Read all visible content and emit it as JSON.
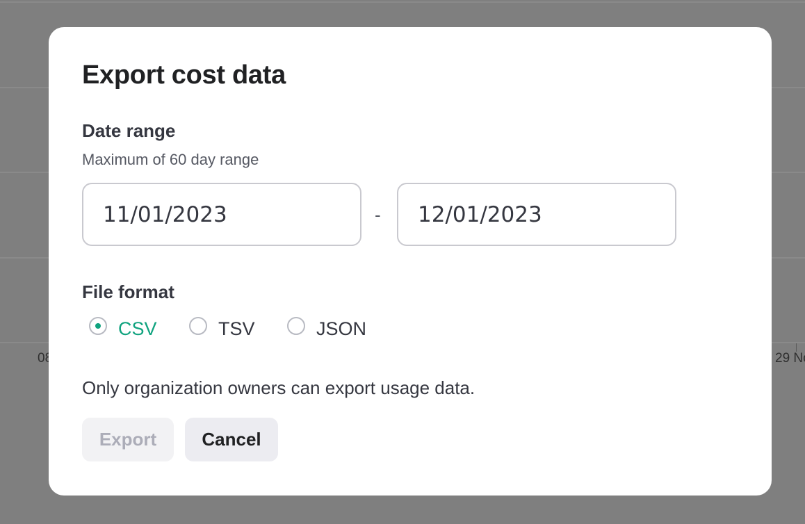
{
  "background_chart": {
    "x_ticks": [
      "08",
      "29 No"
    ]
  },
  "dialog": {
    "title": "Export cost data",
    "date_range": {
      "label": "Date range",
      "hint": "Maximum of 60 day range",
      "start_value": "11/01/2023",
      "separator": "-",
      "end_value": "12/01/2023"
    },
    "file_format": {
      "label": "File format",
      "options": [
        {
          "label": "CSV",
          "selected": true
        },
        {
          "label": "TSV",
          "selected": false
        },
        {
          "label": "JSON",
          "selected": false
        }
      ]
    },
    "notice": "Only organization owners can export usage data.",
    "buttons": {
      "export_label": "Export",
      "export_enabled": false,
      "cancel_label": "Cancel"
    }
  },
  "colors": {
    "overlay": "#7f7f7f",
    "accent": "#10a37f",
    "text_primary": "#202123",
    "button_disabled_text": "#acadb8"
  }
}
